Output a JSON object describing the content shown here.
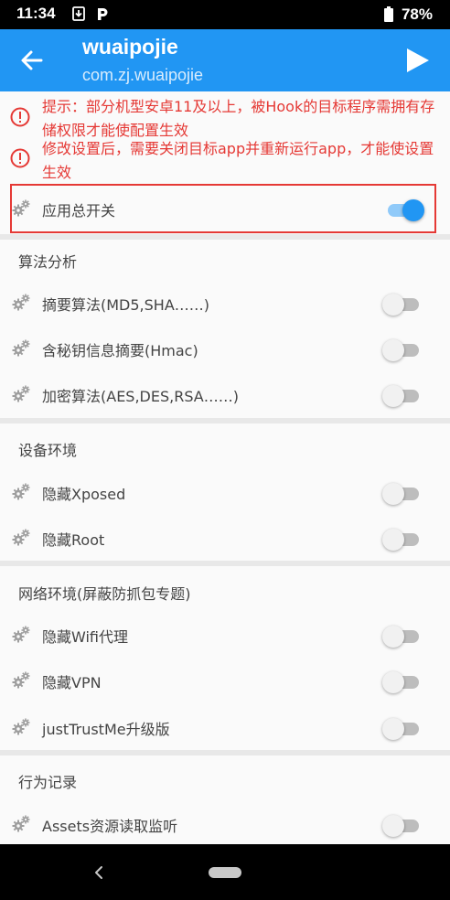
{
  "status_bar": {
    "time": "11:34",
    "battery_percent": "78%"
  },
  "app_bar": {
    "title": "wuaipojie",
    "subtitle": "com.zj.wuaipojie"
  },
  "notices": [
    {
      "text": "提示：部分机型安卓11及以上，被Hook的目标程序需拥有存储权限才能使配置生效"
    },
    {
      "text": "修改设置后，需要关闭目标app并重新运行app，才能使设置生效"
    }
  ],
  "master_switch": {
    "label": "应用总开关",
    "on": true
  },
  "sections": [
    {
      "header": "算法分析",
      "items": [
        {
          "label": "摘要算法(MD5,SHA……)",
          "on": false
        },
        {
          "label": "含秘钥信息摘要(Hmac)",
          "on": false
        },
        {
          "label": "加密算法(AES,DES,RSA……)",
          "on": false
        }
      ]
    },
    {
      "header": "设备环境",
      "items": [
        {
          "label": "隐藏Xposed",
          "on": false
        },
        {
          "label": "隐藏Root",
          "on": false
        }
      ]
    },
    {
      "header": "网络环境(屏蔽防抓包专题)",
      "items": [
        {
          "label": "隐藏Wifi代理",
          "on": false
        },
        {
          "label": "隐藏VPN",
          "on": false
        },
        {
          "label": "justTrustMe升级版",
          "on": false
        }
      ]
    },
    {
      "header": "行为记录",
      "items": [
        {
          "label": "Assets资源读取监听",
          "on": false
        }
      ]
    }
  ],
  "colors": {
    "primary": "#2196f3",
    "warning": "#e53935",
    "switch_off": "#bdbdbd"
  }
}
